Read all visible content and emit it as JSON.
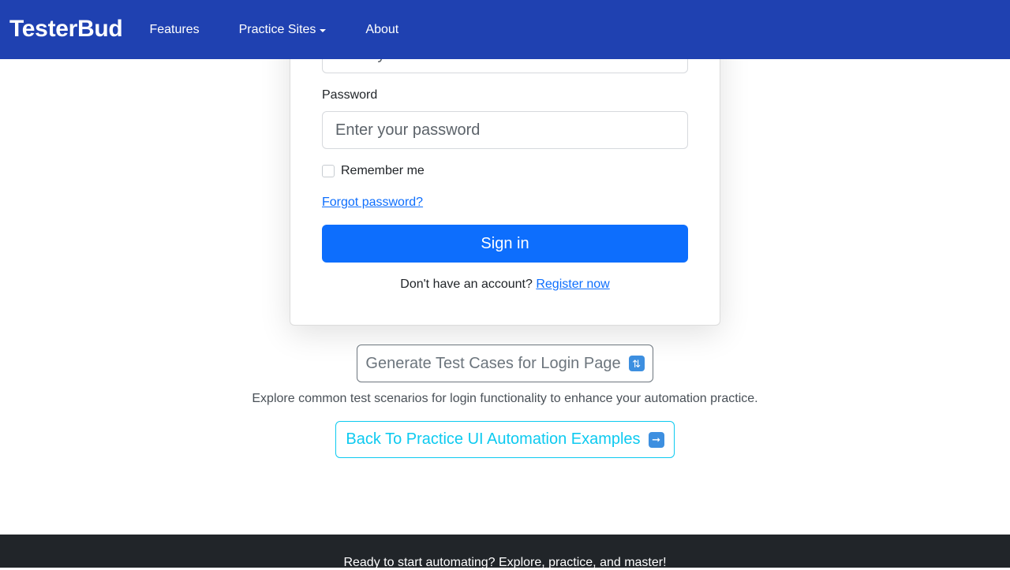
{
  "navbar": {
    "brand": "TesterBud",
    "links": [
      "Features",
      "Practice Sites",
      "About"
    ]
  },
  "form": {
    "email_placeholder": "Enter your email",
    "password_label": "Password",
    "password_placeholder": "Enter your password",
    "remember_label": "Remember me",
    "forgot_link": "Forgot password?",
    "signin_label": "Sign in",
    "register_prompt": "Don't have an account?",
    "register_link": "Register now"
  },
  "actions": {
    "generate_label": "Generate Test Cases for Login Page",
    "generate_icon": "repeat-emoji-icon",
    "explore_text": "Explore common test scenarios for login functionality to enhance your automation practice.",
    "back_label": "Back To Practice UI Automation Examples",
    "back_icon": "right-arrow-emoji-icon"
  },
  "footer": {
    "text": "Ready to start automating? Explore, practice, and master!"
  },
  "colors": {
    "navbar": "#1f41b1",
    "primary": "#0d6efd",
    "secondary": "#6c757d",
    "info": "#0dcaf0",
    "footer": "#212529"
  }
}
